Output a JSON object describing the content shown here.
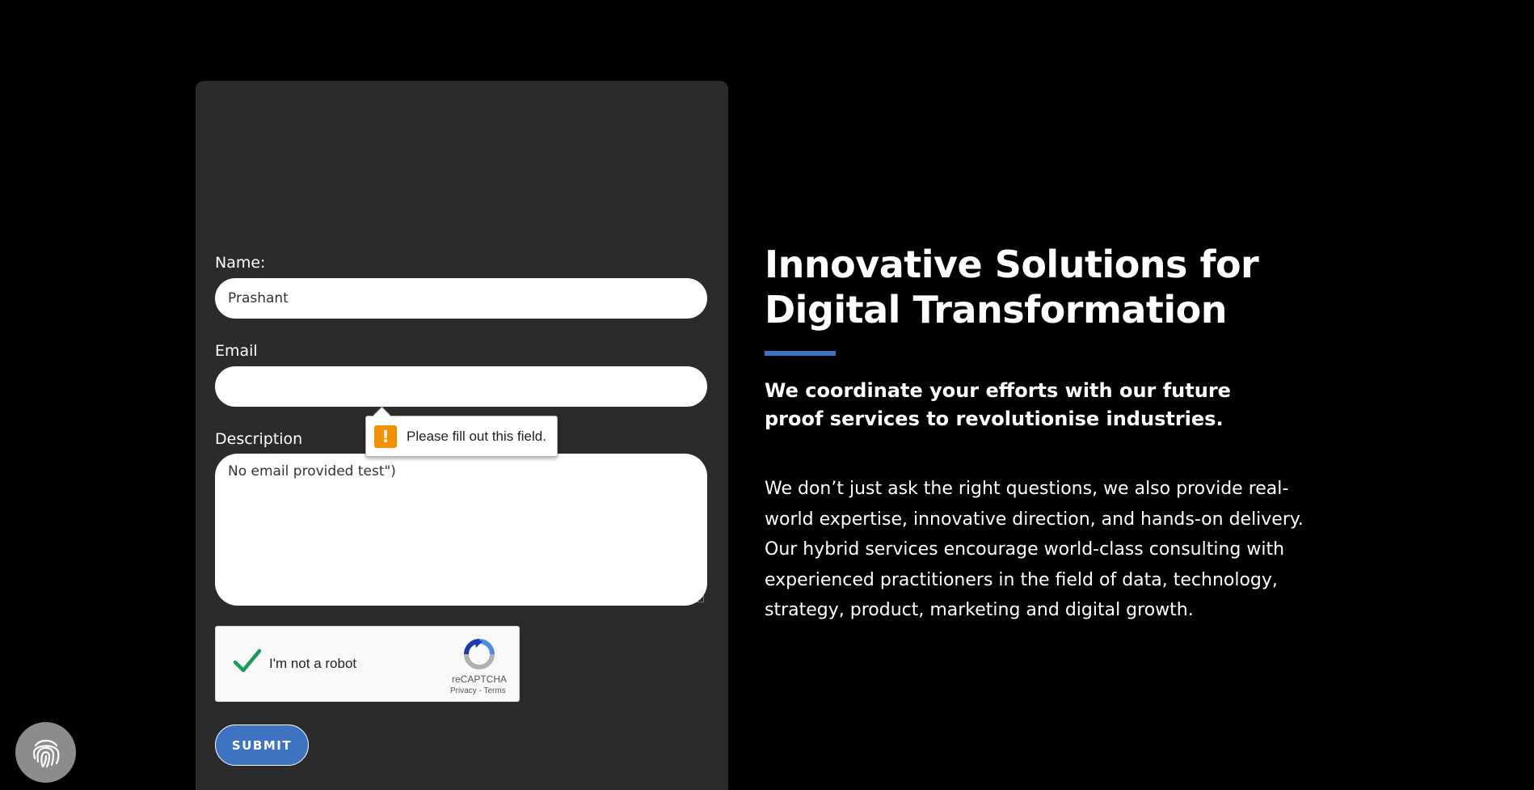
{
  "form": {
    "name_label": "Name:",
    "name_value": "Prashant",
    "email_label": "Email",
    "email_value": "",
    "description_label": "Description",
    "description_value": "No email provided test\")",
    "validation_message": "Please fill out this field.",
    "recaptcha": {
      "label": "I'm not a robot",
      "brand": "reCAPTCHA",
      "links": "Privacy - Terms",
      "checked": true
    },
    "submit_label": "SUBMIT"
  },
  "hero": {
    "headline": "Innovative Solutions for Digital Transformation",
    "subheadline": "We coordinate your efforts with our future proof services to revolutionise industries.",
    "body": "We don’t just ask the right questions, we also provide real-world expertise, innovative direction, and hands-on delivery. Our hybrid services encourage world-class consulting with experienced practitioners in the field of data, technology, strategy, product, marketing and digital growth."
  },
  "colors": {
    "background": "#000000",
    "card": "#2b2b2b",
    "accent": "#3d73c1",
    "warning": "#f39200"
  },
  "icons": {
    "warning": "exclamation-icon",
    "recaptcha_check": "checkmark-icon",
    "recaptcha_logo": "recaptcha-logo-icon",
    "badge": "fingerprint-icon"
  }
}
